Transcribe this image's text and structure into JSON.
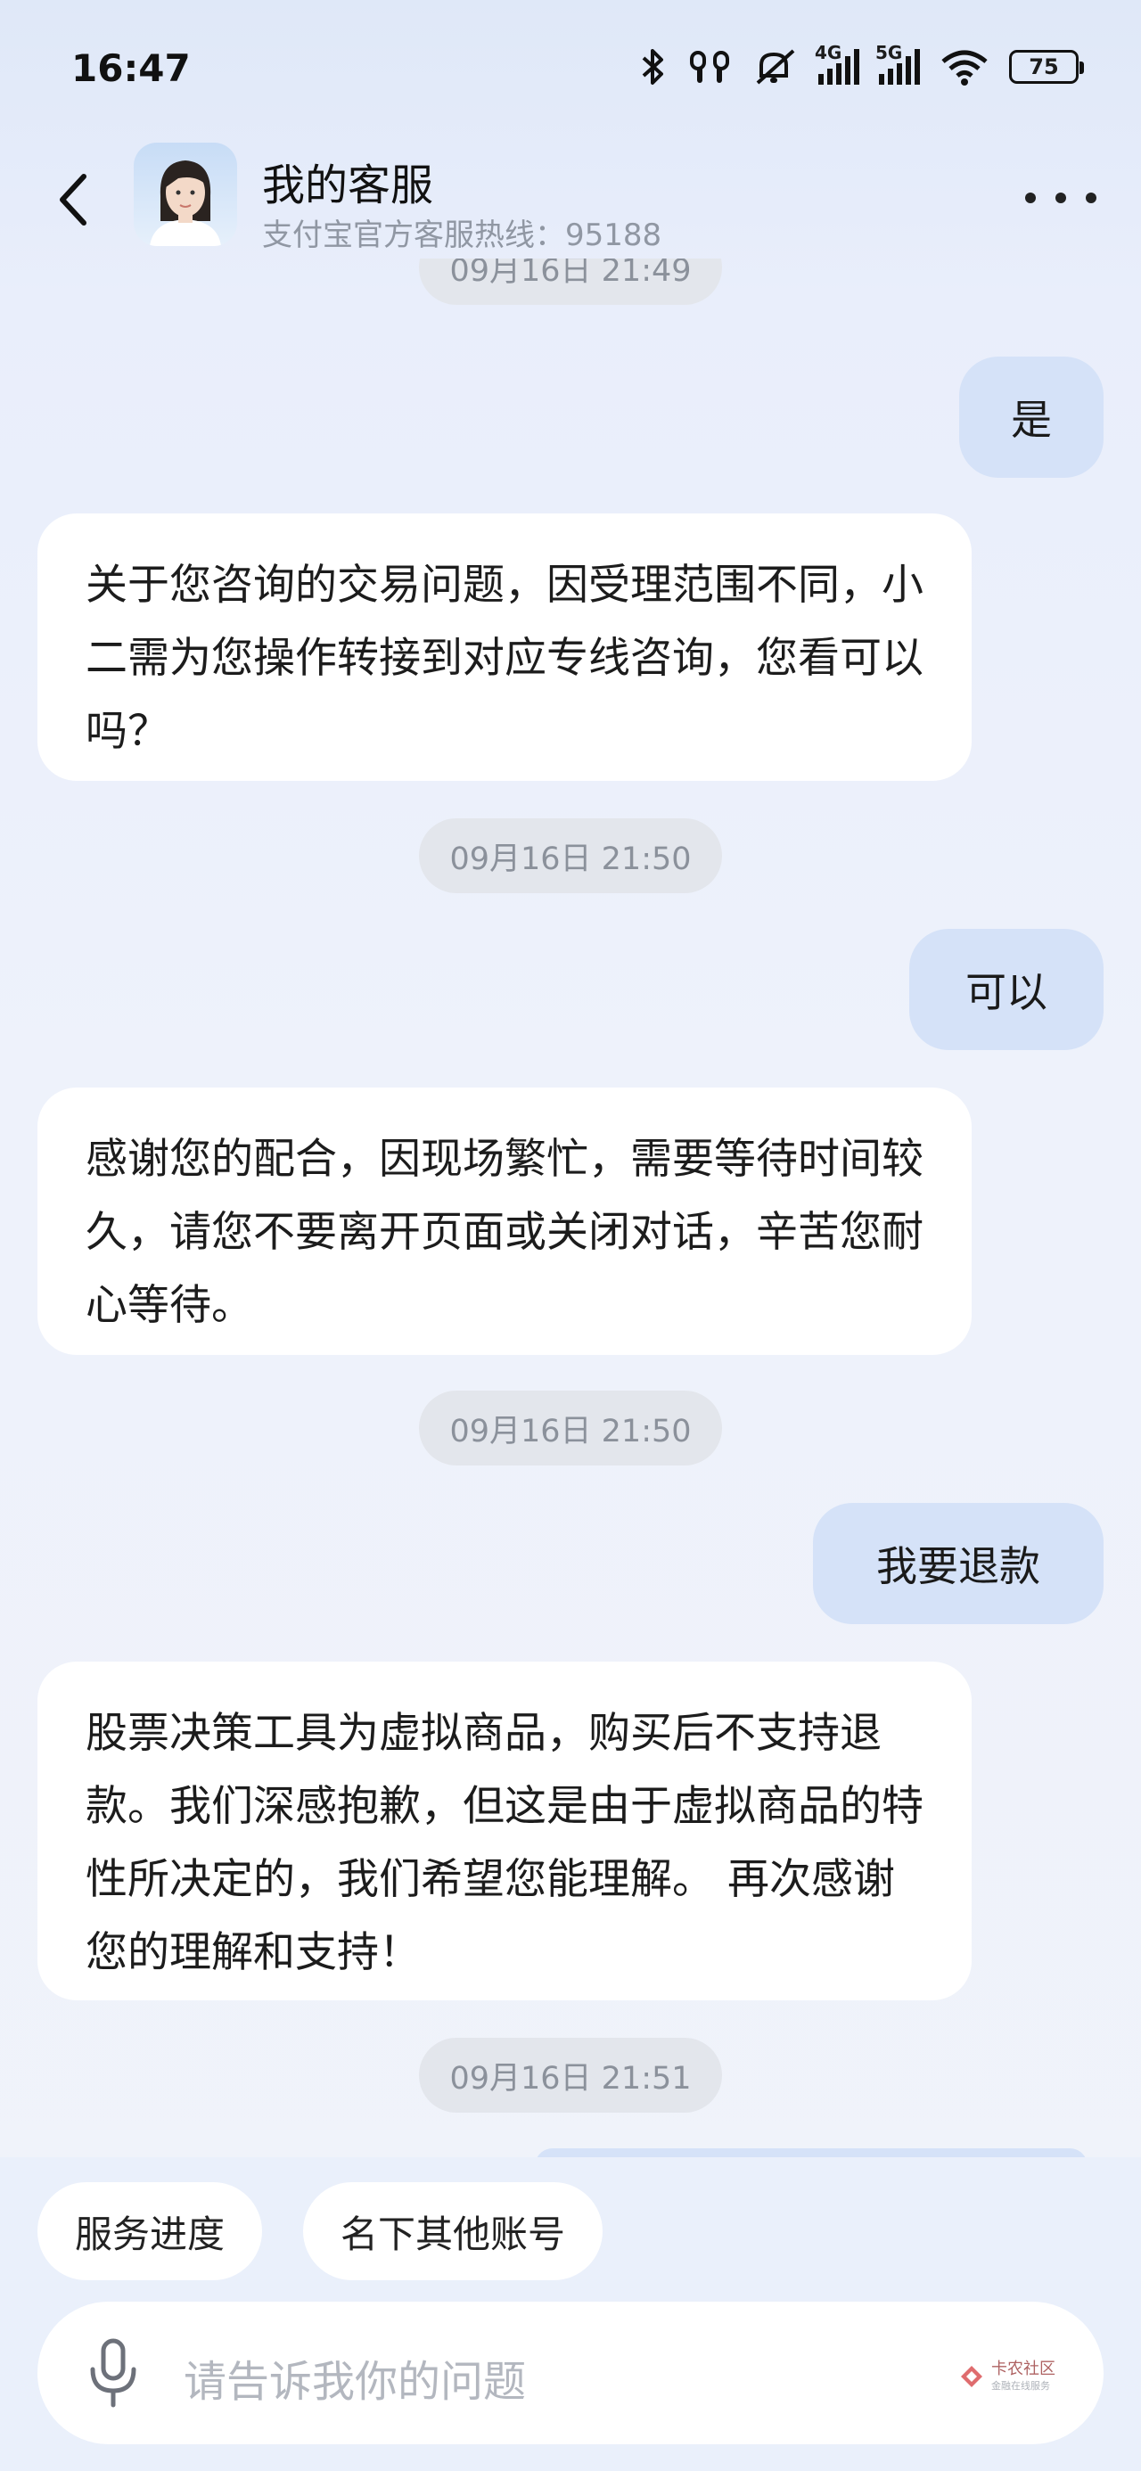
{
  "status_bar": {
    "time": "16:47",
    "network_4g": "4G",
    "network_5g": "5G",
    "battery": "75"
  },
  "header": {
    "title": "我的客服",
    "subtitle": "支付宝官方客服热线：95188"
  },
  "messages": {
    "ts1": "09月16日 21:49",
    "user1": "是",
    "bot1": "关于您咨询的交易问题，因受理范围不同，小二需为您操作转接到对应专线咨询，您看可以吗？",
    "ts2": "09月16日 21:50",
    "user2": "可以",
    "bot2": "感谢您的配合，因现场繁忙，需要等待时间较久，请您不要离开页面或关闭对话，辛苦您耐心等待。",
    "ts3": "09月16日 21:50",
    "user3": "我要退款",
    "bot3": "股票决策工具为虚拟商品，购买后不支持退款。我们深感抱歉，但这是由于虚拟商品的特性所决定的，我们希望您能理解。 再次感谢您的理解和支持！",
    "ts4": "09月16日 21:51"
  },
  "quick_actions": [
    "服务进度",
    "名下其他账号"
  ],
  "input": {
    "placeholder": "请告诉我你的问题"
  },
  "watermark": {
    "text": "卡农社区",
    "sub": "金融在线服务"
  },
  "colors": {
    "user_bubble": "#d5e2f8",
    "bot_bubble": "#ffffff",
    "timestamp_bg": "#e3e6ec"
  }
}
